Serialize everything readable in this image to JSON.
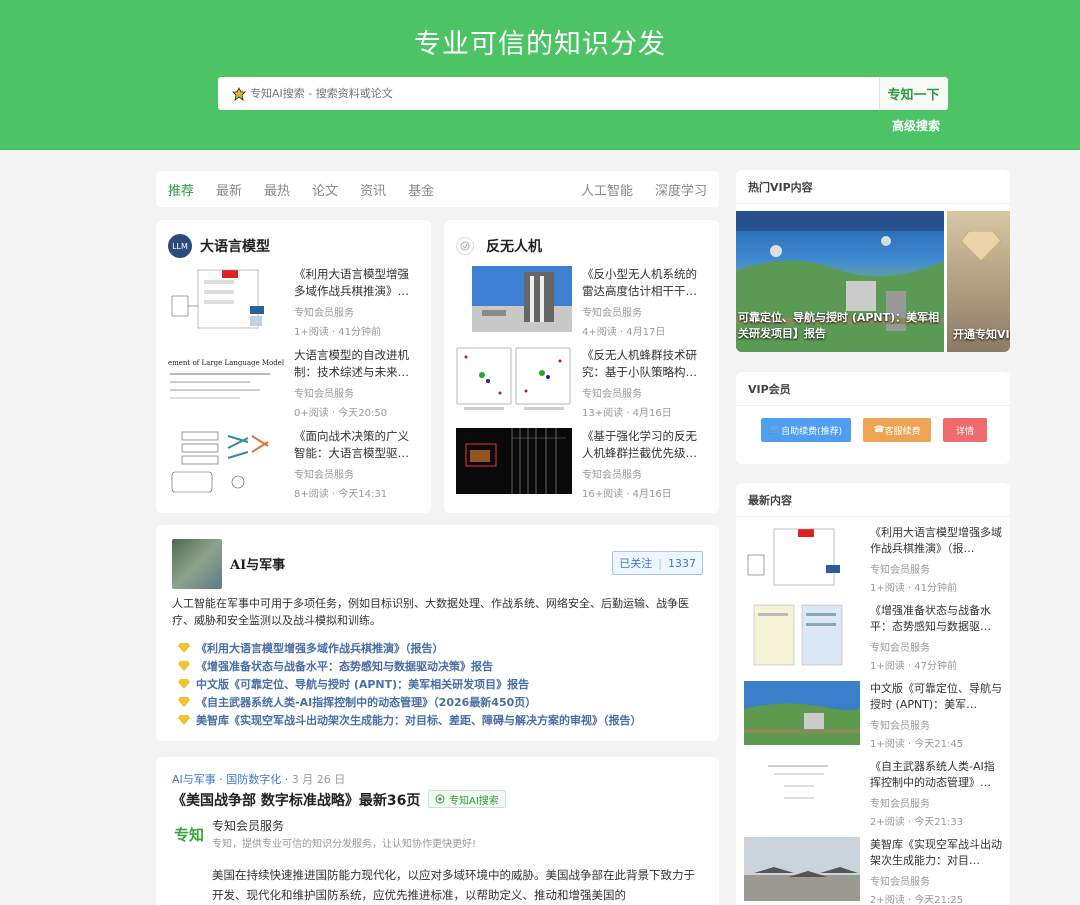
{
  "header": {
    "title": "专业可信的知识分发",
    "search_placeholder": "专知AI搜索 - 搜索资料或论文",
    "search_button": "专知一下",
    "advanced_search": "高级搜索"
  },
  "tabs": {
    "left": [
      "推荐",
      "最新",
      "最热",
      "论文",
      "资讯",
      "基金"
    ],
    "right": [
      "人工智能",
      "深度学习"
    ]
  },
  "categories": [
    {
      "title": "大语言模型",
      "avatar": "LLM",
      "items": [
        {
          "title": "《利用大语言模型增强多域作战兵棋推演》…",
          "source": "专知会员服务",
          "meta": "1+阅读 · 41分钟前"
        },
        {
          "title": "大语言模型的自改进机制：技术综述与未来…",
          "source": "专知会员服务",
          "meta": "0+阅读 · 今天20:50",
          "thumb_text": "ement of Large Language Models: A T"
        },
        {
          "title": "《面向战术决策的广义智能：大语言模型驱…",
          "source": "专知会员服务",
          "meta": "8+阅读 · 今天14:31"
        }
      ]
    },
    {
      "title": "反无人机",
      "items": [
        {
          "title": "《反小型无人机系统的雷达高度估计相干干…",
          "source": "专知会员服务",
          "meta": "4+阅读 · 4月17日"
        },
        {
          "title": "《反无人机蜂群技术研究：基于小队策略构…",
          "source": "专知会员服务",
          "meta": "13+阅读 · 4月16日"
        },
        {
          "title": "《基于强化学习的反无人机蜂群拦截优先级…",
          "source": "专知会员服务",
          "meta": "16+阅读 · 4月16日"
        }
      ]
    }
  ],
  "ai_military": {
    "name": "AI与军事",
    "follow_label": "已关注",
    "follow_count": "1337",
    "description": "人工智能在军事中可用于多项任务，例如目标识别、大数据处理、作战系统、网络安全、后勤运输、战争医疗、威胁和安全监测以及战斗模拟和训练。",
    "links": [
      "《利用大语言模型增强多域作战兵棋推演》（报告）",
      "《增强准备状态与战备水平：态势感知与数据驱动决策》报告",
      "中文版《可靠定位、导航与授时 (APNT)：美军相关研发项目》报告",
      "《自主武器系统人类-AI指挥控制中的动态管理》（2026最新450页）",
      "美智库《实现空军战斗出动架次生成能力：对目标、差距、障碍与解决方案的审视》（报告）"
    ]
  },
  "article": {
    "tag1": "AI与军事",
    "tag2": "国防数字化",
    "date": "3 月 26 日",
    "title": "《美国战争部 数字标准战略》最新36页",
    "ai_chip": "专知AI搜索",
    "logo": "专知",
    "author": "专知会员服务",
    "slogan": "专知，提供专业可信的知识分发服务，让认知协作更快更好!",
    "body": "美国在持续快速推进国防能力现代化，以应对多域环境中的威胁。美国战争部在此背景下致力于开发、现代化和维护国防系统，应优先推进标准，以帮助定义、推动和增强美国的"
  },
  "sidebar": {
    "hot_vip": {
      "title": "热门VIP内容",
      "banner1": "可靠定位、导航与授时 (APNT)：美军相关研发项目】报告",
      "banner2": "开通专知VIP"
    },
    "vip": {
      "title": "VIP会员",
      "btn1": "自助续费(推荐)",
      "btn2": "客服续费",
      "btn3": "详情",
      "btn1_color": "#4f9ef4",
      "btn2_color": "#eea455",
      "btn3_color": "#ef6c6c"
    },
    "latest": {
      "title": "最新内容",
      "items": [
        {
          "title": "《利用大语言模型增强多域作战兵棋推演》（报…",
          "source": "专知会员服务",
          "meta": "1+阅读 · 41分钟前"
        },
        {
          "title": "《增强准备状态与战备水平：态势感知与数据驱…",
          "source": "专知会员服务",
          "meta": "1+阅读 · 47分钟前"
        },
        {
          "title": "中文版《可靠定位、导航与授时 (APNT)：美军…",
          "source": "专知会员服务",
          "meta": "1+阅读 · 今天21:45"
        },
        {
          "title": "《自主武器系统人类-AI指挥控制中的动态管理》…",
          "source": "专知会员服务",
          "meta": "2+阅读 · 今天21:33"
        },
        {
          "title": "美智库《实现空军战斗出动架次生成能力：对目…",
          "source": "专知会员服务",
          "meta": "2+阅读 · 今天21:25"
        }
      ]
    }
  },
  "colors": {
    "brand_green": "#4cc466",
    "link_blue": "#4a6fa5"
  }
}
